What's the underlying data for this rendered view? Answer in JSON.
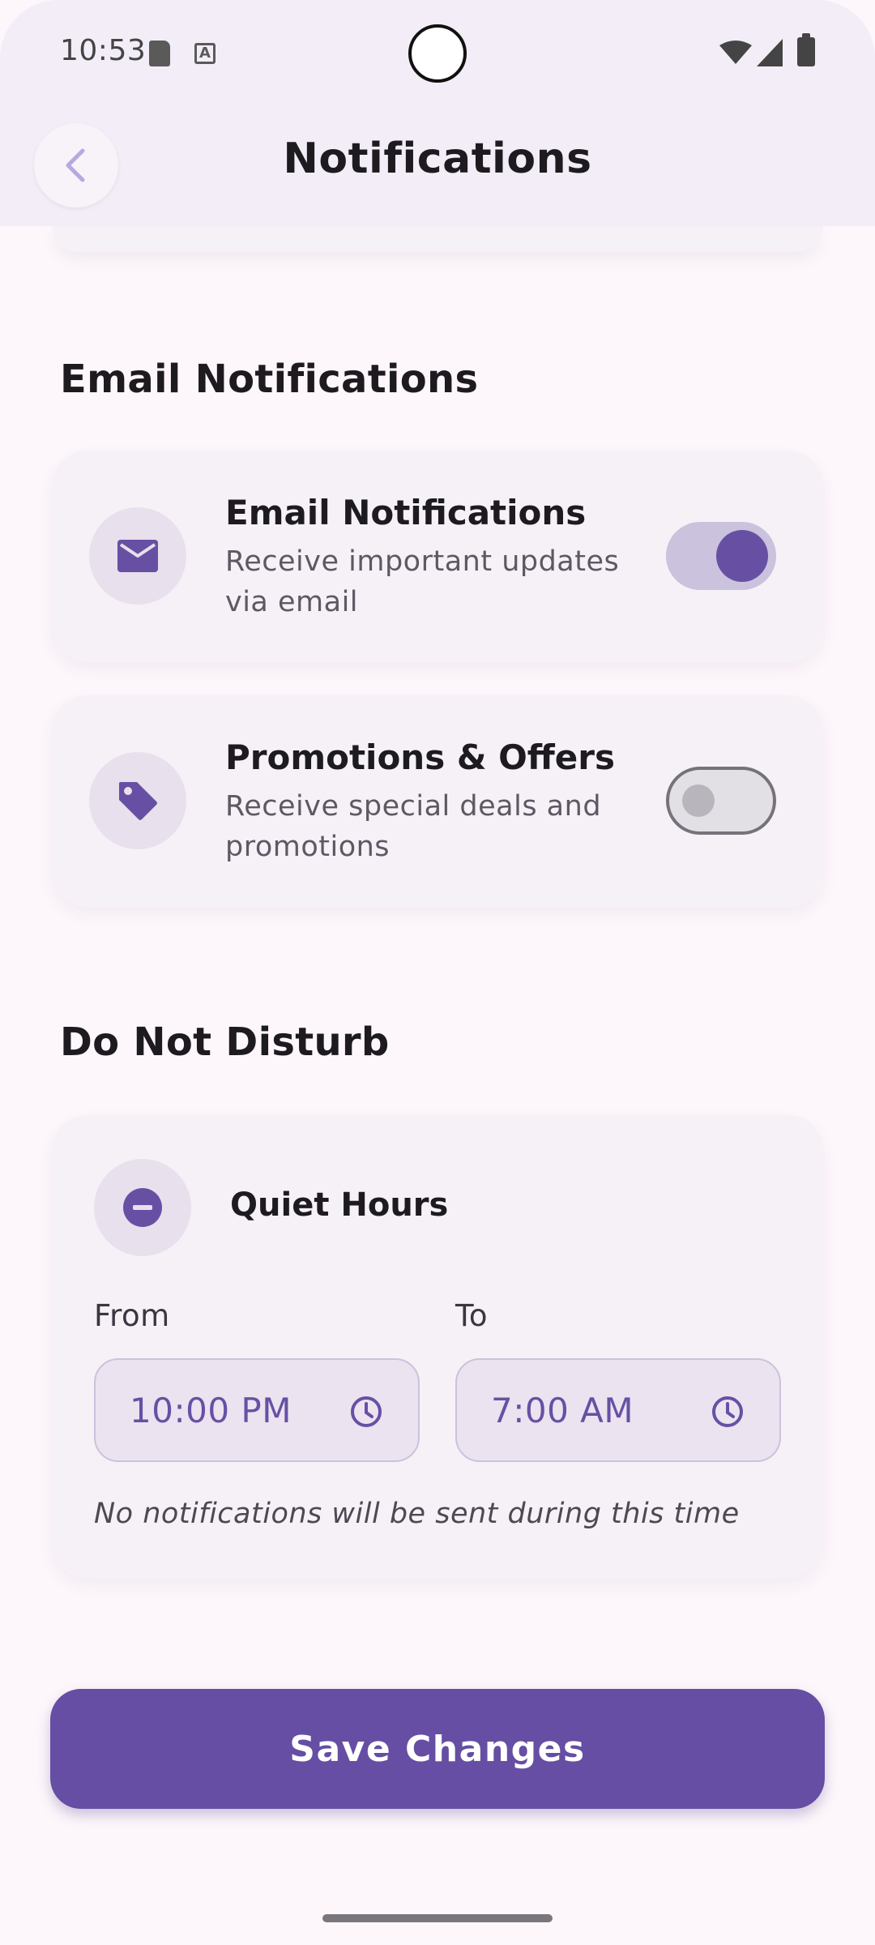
{
  "status_bar": {
    "time": "10:53",
    "icons": [
      "sd-card-icon",
      "keyboard-a-icon",
      "wifi-icon",
      "signal-icon",
      "battery-icon"
    ]
  },
  "header": {
    "title": "Notifications",
    "back_icon": "chevron-left-icon"
  },
  "email_section": {
    "title": "Email Notifications",
    "items": [
      {
        "title": "Email Notifications",
        "description": "Receive important updates via email",
        "icon": "mail-icon",
        "enabled": true
      },
      {
        "title": "Promotions & Offers",
        "description": "Receive special deals and promotions",
        "icon": "tag-icon",
        "enabled": false
      }
    ]
  },
  "dnd_section": {
    "title": "Do Not Disturb",
    "quiet_hours": {
      "title": "Quiet Hours",
      "icon": "minus-circle-icon",
      "from_label": "From",
      "from_value": "10:00 PM",
      "to_label": "To",
      "to_value": "7:00 AM",
      "note": "No notifications will be sent during this time"
    }
  },
  "save_button": {
    "label": "Save Changes"
  },
  "colors": {
    "accent": "#6750a4",
    "button": "#654ea3",
    "background": "#fdf7fb",
    "card": "#f6f1f7"
  }
}
